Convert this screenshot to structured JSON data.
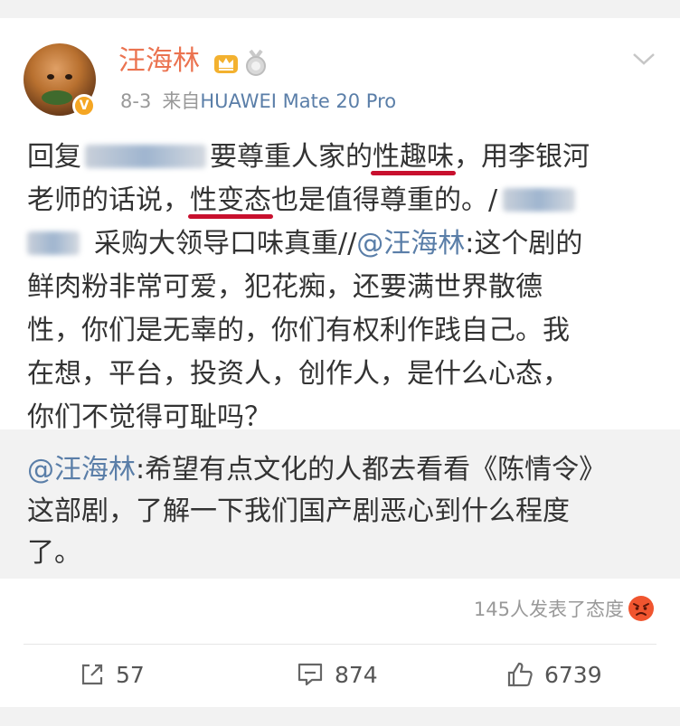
{
  "post": {
    "author": "汪海林",
    "date": "8-3",
    "source_prefix": "来自",
    "device": "HUAWEI Mate 20 Pro",
    "verified_badge": "V",
    "body": {
      "l1_a": "回复",
      "l1_b": "要尊重人家的",
      "l1_c": "性趣味",
      "l1_d": "，用李银河",
      "l2_a": "老师的话说，",
      "l2_b": "性变态",
      "l2_c": "也是值得尊重的。/",
      "l3_a": "采购大领导口味真重//",
      "l3_b": "@汪海林",
      "l3_c": ":这个剧的",
      "l4": "鲜肉粉非常可爱，犯花痴，还要满世界散德",
      "l5": "性，你们是无辜的，你们有权利作践自己。我",
      "l6": "在想，平台，投资人，创作人，是什么心态，",
      "l7": "你们不觉得可耻吗？"
    }
  },
  "repost": {
    "mention": "@汪海林",
    "l1": ":希望有点文化的人都去看看《陈情令》",
    "l2": "这部剧，了解一下我们国产剧恶心到什么程度",
    "l3": "了。"
  },
  "attitudes": {
    "text": "145人发表了态度",
    "icon": "angry-face-icon"
  },
  "actions": {
    "share_count": "57",
    "comment_count": "874",
    "like_count": "6739"
  },
  "colors": {
    "username": "#eb7350",
    "link": "#5a7ea8",
    "underline": "#c8102e",
    "muted": "#999999"
  }
}
